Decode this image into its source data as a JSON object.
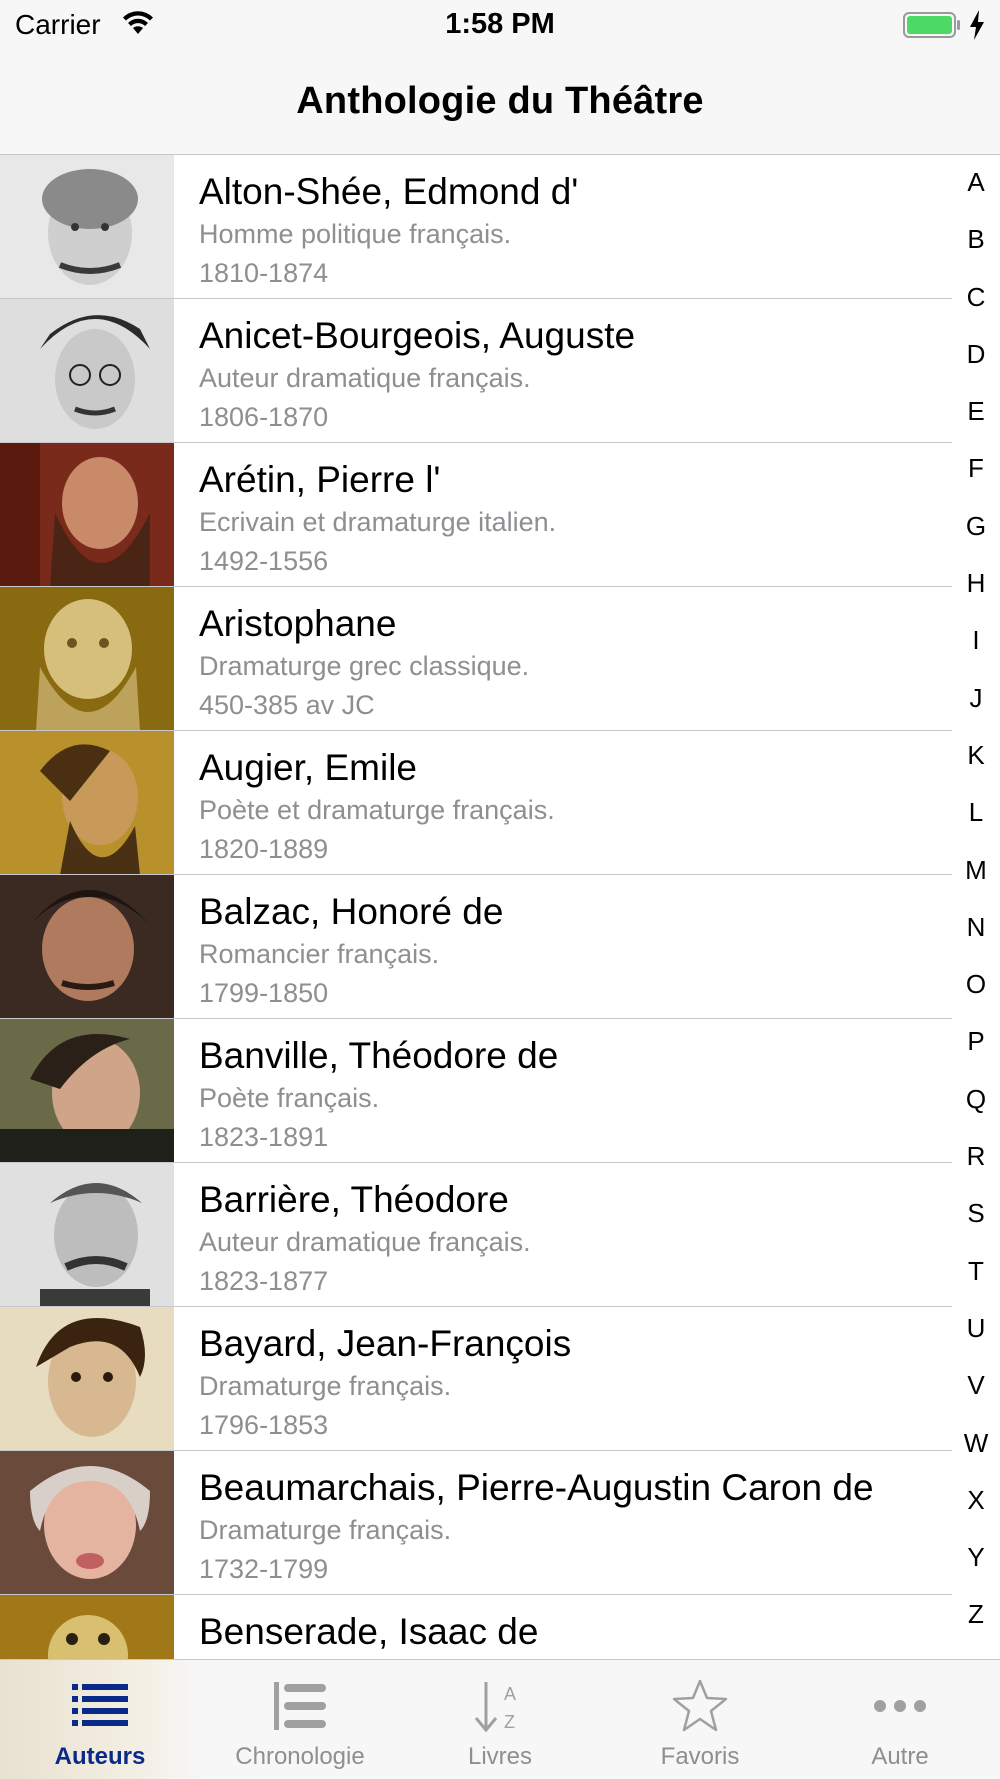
{
  "status_bar": {
    "carrier": "Carrier",
    "time": "1:58 PM",
    "battery_color": "#4cd964"
  },
  "nav": {
    "title": "Anthologie du Théâtre"
  },
  "authors": [
    {
      "name": "Alton-Shée, Edmond d'",
      "description": "Homme politique français.",
      "dates": "1810-1874"
    },
    {
      "name": "Anicet-Bourgeois, Auguste",
      "description": "Auteur dramatique français.",
      "dates": "1806-1870"
    },
    {
      "name": "Arétin, Pierre l'",
      "description": "Ecrivain et dramaturge italien.",
      "dates": "1492-1556"
    },
    {
      "name": "Aristophane",
      "description": "Dramaturge grec classique.",
      "dates": "450-385 av JC"
    },
    {
      "name": "Augier, Emile",
      "description": "Poète et dramaturge français.",
      "dates": "1820-1889"
    },
    {
      "name": "Balzac, Honoré de",
      "description": "Romancier français.",
      "dates": "1799-1850"
    },
    {
      "name": "Banville, Théodore de",
      "description": "Poète français.",
      "dates": "1823-1891"
    },
    {
      "name": "Barrière, Théodore",
      "description": "Auteur dramatique français.",
      "dates": "1823-1877"
    },
    {
      "name": "Bayard, Jean-François",
      "description": "Dramaturge français.",
      "dates": "1796-1853"
    },
    {
      "name": "Beaumarchais, Pierre-Augustin Caron de",
      "description": "Dramaturge français.",
      "dates": "1732-1799"
    },
    {
      "name": "Benserade, Isaac de",
      "description": "",
      "dates": ""
    }
  ],
  "section_index": [
    "A",
    "B",
    "C",
    "D",
    "E",
    "F",
    "G",
    "H",
    "I",
    "J",
    "K",
    "L",
    "M",
    "N",
    "O",
    "P",
    "Q",
    "R",
    "S",
    "T",
    "U",
    "V",
    "W",
    "X",
    "Y",
    "Z"
  ],
  "tabs": [
    {
      "label": "Auteurs",
      "icon": "list-icon",
      "active": true
    },
    {
      "label": "Chronologie",
      "icon": "numbered-list-icon",
      "active": false
    },
    {
      "label": "Livres",
      "icon": "sort-az-icon",
      "active": false
    },
    {
      "label": "Favoris",
      "icon": "star-icon",
      "active": false
    },
    {
      "label": "Autre",
      "icon": "more-icon",
      "active": false
    }
  ],
  "colors": {
    "active_tab": "#0a2a8a",
    "inactive_tab": "#8e8e93",
    "secondary_text": "#8e8e93",
    "separator": "#c8c7cc"
  }
}
